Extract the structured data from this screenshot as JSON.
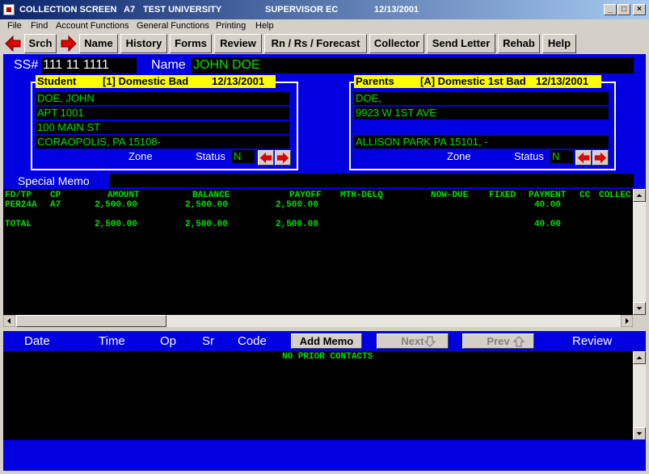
{
  "window": {
    "title_screen": "COLLECTION SCREEN",
    "title_code": "A7",
    "title_school": "TEST UNIVERSITY",
    "title_role": "SUPERVISOR  EC",
    "title_date": "12/13/2001",
    "controls": {
      "minimize": "_",
      "maximize": "□",
      "close": "×"
    }
  },
  "menu": [
    "File",
    "Find",
    "Account Functions",
    "General Functions",
    "Printing",
    "Help"
  ],
  "toolbar": {
    "buttons": [
      "Srch",
      "Name",
      "History",
      "Forms",
      "Review",
      "Rn / Rs / Forecast",
      "Collector",
      "Send Letter",
      "Rehab",
      "Help"
    ]
  },
  "account": {
    "ss_label": "SS#",
    "ss_value": "111 11 1111",
    "name_label": "Name",
    "name_value": "JOHN  DOE"
  },
  "student": {
    "title_label": "Student",
    "title_status": "[1] Domestic Bad",
    "title_date": "12/13/2001",
    "lines": [
      "DOE, JOHN",
      "APT 1001",
      "100 MAIN ST",
      "CORAOPOLIS, PA 15108-"
    ],
    "zone_label": "Zone",
    "zone_value": "",
    "status_label": "Status",
    "status_value": "N"
  },
  "parents": {
    "title_label": "Parents",
    "title_status": "[A] Domestic 1st Bad",
    "title_date": "12/13/2001",
    "lines": [
      "DOE,",
      "9923 W 1ST AVE",
      "",
      "ALLISON PARK PA 15101,      -"
    ],
    "zone_label": "Zone",
    "zone_value": "",
    "status_label": "Status",
    "status_value": "N"
  },
  "memo": {
    "label": "Special Memo",
    "value": ""
  },
  "grid": {
    "headers": [
      "FD/TP",
      "CP",
      "AMOUNT",
      "BALANCE",
      "PAYOFF",
      "MTH-DELQ",
      "NOW-DUE",
      "FIXED",
      "PAYMENT",
      "CC",
      "COLLEC"
    ],
    "row": {
      "fdtp": "PER24A",
      "cp": "A7",
      "amount": "2,500.00",
      "balance": "2,500.00",
      "payoff": "2,500.00",
      "payment": "40.00"
    },
    "total": {
      "label": "TOTAL",
      "amount": "2,500.00",
      "balance": "2,500.00",
      "payoff": "2,500.00",
      "payment": "40.00"
    }
  },
  "contacts": {
    "headers": [
      "Date",
      "Time",
      "Op",
      "Sr",
      "Code"
    ],
    "add_memo": "Add Memo",
    "next": "Next",
    "prev": "Prev",
    "review": "Review",
    "empty_message": "NO PRIOR CONTACTS"
  },
  "colors": {
    "panel_blue": "#0000e0",
    "field_green": "#00e000",
    "title_yellow": "#ffff00",
    "arrow_red": "#e00000"
  },
  "icons": {
    "back": "left-arrow-icon",
    "forward": "right-arrow-icon",
    "next": "down-arrow-icon",
    "prev": "up-arrow-icon"
  }
}
